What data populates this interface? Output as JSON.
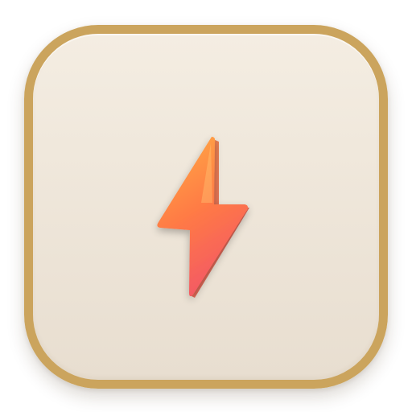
{
  "icon": {
    "name": "lightning-bolt-icon",
    "frame_color": "#CBA45D",
    "background_top": "#F4EDE2",
    "background_bottom": "#E8DED0",
    "bolt_gradient": [
      "#FFAE45",
      "#FF7A45",
      "#F45B63"
    ]
  }
}
